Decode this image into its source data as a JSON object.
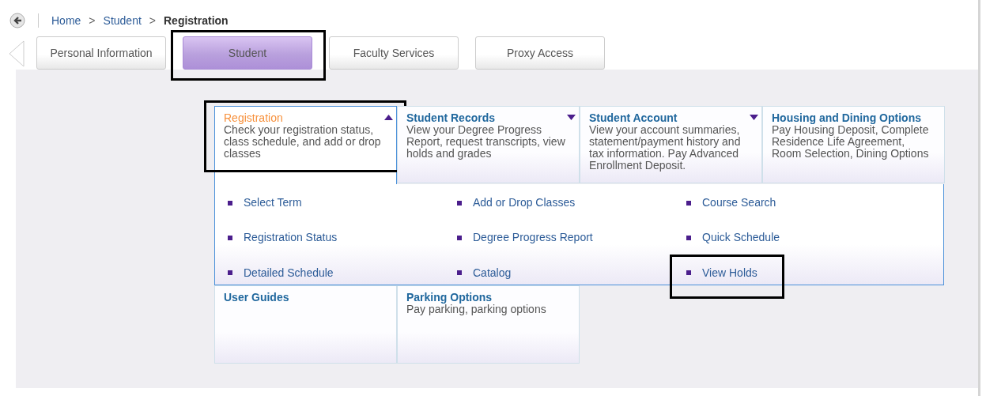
{
  "breadcrumb": [
    {
      "label": "Home",
      "current": false
    },
    {
      "separator_before": ">",
      "label": "Student",
      "current": false
    },
    {
      "separator_before": ">",
      "label": "Registration",
      "current": true
    }
  ],
  "tabs": [
    {
      "label": "Personal Information",
      "selected": false,
      "highlighted": false
    },
    {
      "label": "Student",
      "selected": true,
      "highlighted": true
    },
    {
      "label": "Faculty Services",
      "selected": false,
      "highlighted": false
    },
    {
      "label": "Proxy Access",
      "selected": false,
      "highlighted": false
    }
  ],
  "tiles": [
    {
      "title": "Registration",
      "description": "Check your registration status, class schedule, and add or drop classes",
      "has_menu": true,
      "expanded": true,
      "highlighted": true
    },
    {
      "title": "Student Records",
      "description": "View your Degree Progress Report, request transcripts, view holds and grades",
      "has_menu": true,
      "expanded": false,
      "highlighted": false
    },
    {
      "title": "Student Account",
      "description": "View your account summaries, statement/payment history and tax information. Pay Advanced Enrollment Deposit.",
      "has_menu": true,
      "expanded": false,
      "highlighted": false
    },
    {
      "title": "Housing and Dining Options",
      "description": "Pay Housing Deposit, Complete Residence Life Agreement, Room Selection, Dining Options",
      "has_menu": false,
      "expanded": false,
      "highlighted": false
    }
  ],
  "links": [
    {
      "label": "Select Term",
      "highlighted": false
    },
    {
      "label": "Add or Drop Classes",
      "highlighted": false
    },
    {
      "label": "Course Search",
      "highlighted": false
    },
    {
      "label": "Registration Status",
      "highlighted": false
    },
    {
      "label": "Degree Progress Report",
      "highlighted": false
    },
    {
      "label": "Quick Schedule",
      "highlighted": false
    },
    {
      "label": "Detailed Schedule",
      "highlighted": false
    },
    {
      "label": "Catalog",
      "highlighted": false
    },
    {
      "label": "View Holds",
      "highlighted": true
    }
  ],
  "lower_tiles": [
    {
      "title": "User Guides"
    },
    {
      "title": "Parking Options",
      "description": "Pay parking, parking options"
    }
  ]
}
